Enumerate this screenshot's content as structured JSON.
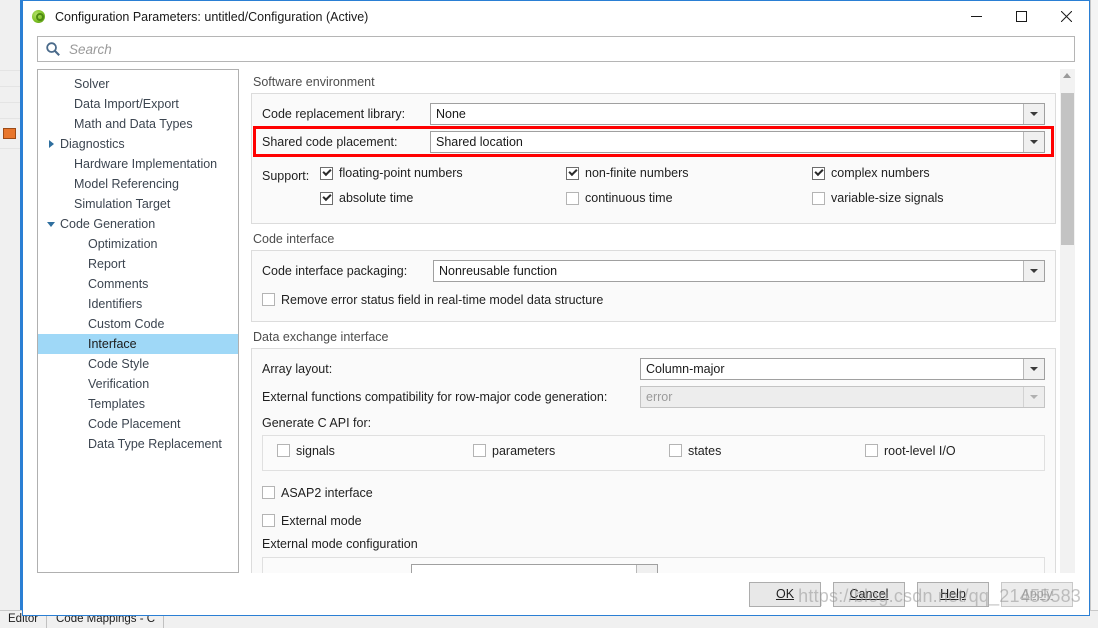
{
  "window": {
    "title": "Configuration Parameters: untitled/Configuration (Active)",
    "app_icon": "matlab-simulink-icon",
    "minimize_label": "minimize-icon",
    "maximize_label": "maximize-icon",
    "close_label": "close-icon"
  },
  "search": {
    "placeholder": "Search",
    "value": "",
    "icon": "search-icon"
  },
  "tree": {
    "items": [
      {
        "label": "Solver",
        "depth": 1,
        "twisty": "none",
        "selected": false
      },
      {
        "label": "Data Import/Export",
        "depth": 1,
        "twisty": "none",
        "selected": false
      },
      {
        "label": "Math and Data Types",
        "depth": 1,
        "twisty": "none",
        "selected": false
      },
      {
        "label": "Diagnostics",
        "depth": 0,
        "twisty": "collapsed",
        "selected": false
      },
      {
        "label": "Hardware Implementation",
        "depth": 1,
        "twisty": "none",
        "selected": false
      },
      {
        "label": "Model Referencing",
        "depth": 1,
        "twisty": "none",
        "selected": false
      },
      {
        "label": "Simulation Target",
        "depth": 1,
        "twisty": "none",
        "selected": false
      },
      {
        "label": "Code Generation",
        "depth": 0,
        "twisty": "expanded",
        "selected": false
      },
      {
        "label": "Optimization",
        "depth": 2,
        "twisty": "none",
        "selected": false
      },
      {
        "label": "Report",
        "depth": 2,
        "twisty": "none",
        "selected": false
      },
      {
        "label": "Comments",
        "depth": 2,
        "twisty": "none",
        "selected": false
      },
      {
        "label": "Identifiers",
        "depth": 2,
        "twisty": "none",
        "selected": false
      },
      {
        "label": "Custom Code",
        "depth": 2,
        "twisty": "none",
        "selected": false
      },
      {
        "label": "Interface",
        "depth": 2,
        "twisty": "none",
        "selected": true
      },
      {
        "label": "Code Style",
        "depth": 2,
        "twisty": "none",
        "selected": false
      },
      {
        "label": "Verification",
        "depth": 2,
        "twisty": "none",
        "selected": false
      },
      {
        "label": "Templates",
        "depth": 2,
        "twisty": "none",
        "selected": false
      },
      {
        "label": "Code Placement",
        "depth": 2,
        "twisty": "none",
        "selected": false
      },
      {
        "label": "Data Type Replacement",
        "depth": 2,
        "twisty": "none",
        "selected": false
      }
    ]
  },
  "software_environment": {
    "title": "Software environment",
    "code_replacement_library": {
      "label": "Code replacement library:",
      "value": "None"
    },
    "shared_code_placement": {
      "label": "Shared code placement:",
      "value": "Shared location",
      "highlighted": true,
      "highlight_color": "#ff0000"
    },
    "support_label": "Support:",
    "checkboxes": [
      {
        "label": "floating-point numbers",
        "checked": true
      },
      {
        "label": "non-finite numbers",
        "checked": true
      },
      {
        "label": "complex numbers",
        "checked": true
      },
      {
        "label": "absolute time",
        "checked": true
      },
      {
        "label": "continuous time",
        "checked": false
      },
      {
        "label": "variable-size signals",
        "checked": false
      }
    ]
  },
  "code_interface": {
    "title": "Code interface",
    "packaging": {
      "label": "Code interface packaging:",
      "value": "Nonreusable function"
    },
    "remove_error_status": {
      "label": "Remove error status field in real-time model data structure",
      "checked": false
    }
  },
  "data_exchange": {
    "title": "Data exchange interface",
    "array_layout": {
      "label": "Array layout:",
      "value": "Column-major"
    },
    "external_functions": {
      "label": "External functions compatibility for row-major code generation:",
      "value": "error",
      "disabled": true
    },
    "generate_c_api_label": "Generate C API for:",
    "c_api_checkboxes": [
      {
        "label": "signals",
        "checked": false
      },
      {
        "label": "parameters",
        "checked": false
      },
      {
        "label": "states",
        "checked": false
      },
      {
        "label": "root-level I/O",
        "checked": false
      }
    ],
    "asap2": {
      "label": "ASAP2 interface",
      "checked": false
    },
    "external_mode": {
      "label": "External mode",
      "checked": false
    },
    "external_mode_configuration_title": "External mode configuration"
  },
  "footer": {
    "ok": "OK",
    "cancel": "Cancel",
    "help": "Help",
    "apply": "Apply",
    "apply_disabled": true,
    "watermark": "https://blog.csdn.net/qq_21455583"
  },
  "background": {
    "tabs": [
      {
        "label": "Editor"
      },
      {
        "label": "Code Mappings - C"
      }
    ]
  }
}
